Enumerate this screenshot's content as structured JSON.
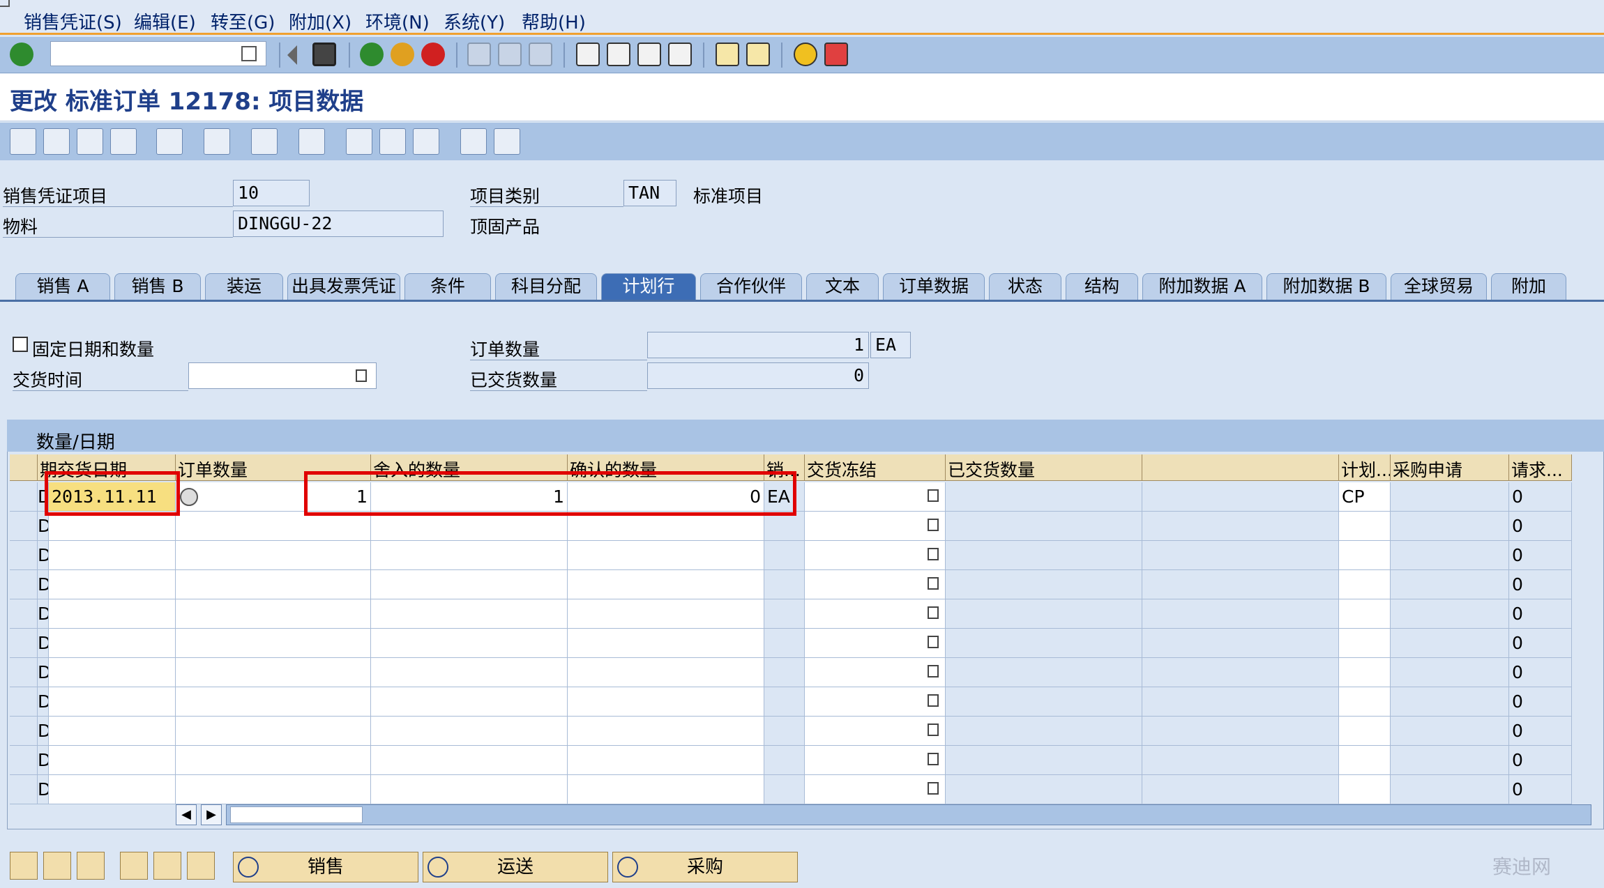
{
  "menu": [
    "销售凭证(S)",
    "编辑(E)",
    "转至(G)",
    "附加(X)",
    "环境(N)",
    "系统(Y)",
    "帮助(H)"
  ],
  "toolbar": {
    "command_field_value": "",
    "icons": [
      "enter-icon",
      "back-icon",
      "save-icon",
      "back-green-icon",
      "exit-icon",
      "cancel-icon",
      "print-icon",
      "find-icon",
      "find-next-icon",
      "first-page-icon",
      "prev-page-icon",
      "next-page-icon",
      "last-page-icon",
      "create-session-icon",
      "shortcut-icon",
      "help-icon",
      "layout-icon"
    ]
  },
  "title": "更改 标准订单 12178: 项目数据",
  "header": {
    "item_label": "销售凭证项目",
    "item_value": "10",
    "material_label": "物料",
    "material_value": "DINGGU-22",
    "item_category_label": "项目类别",
    "item_category_value": "TAN",
    "item_category_desc": "标准项目",
    "material_desc": "顶固产品"
  },
  "tabs": [
    {
      "label": "销售 A",
      "active": false
    },
    {
      "label": "销售 B",
      "active": false
    },
    {
      "label": "装运",
      "active": false
    },
    {
      "label": "出具发票凭证",
      "active": false
    },
    {
      "label": "条件",
      "active": false
    },
    {
      "label": "科目分配",
      "active": false
    },
    {
      "label": "计划行",
      "active": true
    },
    {
      "label": "合作伙伴",
      "active": false
    },
    {
      "label": "文本",
      "active": false
    },
    {
      "label": "订单数据",
      "active": false
    },
    {
      "label": "状态",
      "active": false
    },
    {
      "label": "结构",
      "active": false
    },
    {
      "label": "附加数据 A",
      "active": false
    },
    {
      "label": "附加数据 B",
      "active": false
    },
    {
      "label": "全球贸易",
      "active": false
    },
    {
      "label": "附加",
      "active": false
    }
  ],
  "schedule": {
    "fixed_date_qty_label": "固定日期和数量",
    "fixed_date_qty_checked": false,
    "delivery_time_label": "交货时间",
    "delivery_time_value": "",
    "order_qty_label": "订单数量",
    "order_qty_value": "1",
    "order_qty_unit": "EA",
    "delivered_qty_label": "已交货数量",
    "delivered_qty_value": "0"
  },
  "table": {
    "title": "数量/日期",
    "columns": [
      "期",
      "交货日期",
      "订单数量",
      "舍入的数量",
      "确认的数量",
      "销...",
      "交货冻结",
      "已交货数量",
      "",
      "计划...",
      "采购申请",
      "请求..."
    ],
    "rows": [
      {
        "cat": "D",
        "date": "2013.11.11",
        "order_qty": "1",
        "rounded_qty": "1",
        "confirmed_qty": "0",
        "unit": "EA",
        "block": "",
        "delivered": "",
        "blank": "",
        "sched_type": "CP",
        "pr": "",
        "req": "0"
      },
      {
        "cat": "D",
        "date": "",
        "order_qty": "",
        "rounded_qty": "",
        "confirmed_qty": "",
        "unit": "",
        "block": "",
        "delivered": "",
        "blank": "",
        "sched_type": "",
        "pr": "",
        "req": "0"
      },
      {
        "cat": "D",
        "date": "",
        "order_qty": "",
        "rounded_qty": "",
        "confirmed_qty": "",
        "unit": "",
        "block": "",
        "delivered": "",
        "blank": "",
        "sched_type": "",
        "pr": "",
        "req": "0"
      },
      {
        "cat": "D",
        "date": "",
        "order_qty": "",
        "rounded_qty": "",
        "confirmed_qty": "",
        "unit": "",
        "block": "",
        "delivered": "",
        "blank": "",
        "sched_type": "",
        "pr": "",
        "req": "0"
      },
      {
        "cat": "D",
        "date": "",
        "order_qty": "",
        "rounded_qty": "",
        "confirmed_qty": "",
        "unit": "",
        "block": "",
        "delivered": "",
        "blank": "",
        "sched_type": "",
        "pr": "",
        "req": "0"
      },
      {
        "cat": "D",
        "date": "",
        "order_qty": "",
        "rounded_qty": "",
        "confirmed_qty": "",
        "unit": "",
        "block": "",
        "delivered": "",
        "blank": "",
        "sched_type": "",
        "pr": "",
        "req": "0"
      },
      {
        "cat": "D",
        "date": "",
        "order_qty": "",
        "rounded_qty": "",
        "confirmed_qty": "",
        "unit": "",
        "block": "",
        "delivered": "",
        "blank": "",
        "sched_type": "",
        "pr": "",
        "req": "0"
      },
      {
        "cat": "D",
        "date": "",
        "order_qty": "",
        "rounded_qty": "",
        "confirmed_qty": "",
        "unit": "",
        "block": "",
        "delivered": "",
        "blank": "",
        "sched_type": "",
        "pr": "",
        "req": "0"
      },
      {
        "cat": "D",
        "date": "",
        "order_qty": "",
        "rounded_qty": "",
        "confirmed_qty": "",
        "unit": "",
        "block": "",
        "delivered": "",
        "blank": "",
        "sched_type": "",
        "pr": "",
        "req": "0"
      },
      {
        "cat": "D",
        "date": "",
        "order_qty": "",
        "rounded_qty": "",
        "confirmed_qty": "",
        "unit": "",
        "block": "",
        "delivered": "",
        "blank": "",
        "sched_type": "",
        "pr": "",
        "req": "0"
      },
      {
        "cat": "D",
        "date": "",
        "order_qty": "",
        "rounded_qty": "",
        "confirmed_qty": "",
        "unit": "",
        "block": "",
        "delivered": "",
        "blank": "",
        "sched_type": "",
        "pr": "",
        "req": "0"
      }
    ]
  },
  "bottom_buttons": {
    "sales": "销售",
    "shipping": "运送",
    "purchasing": "采购"
  },
  "watermark": "赛迪网"
}
